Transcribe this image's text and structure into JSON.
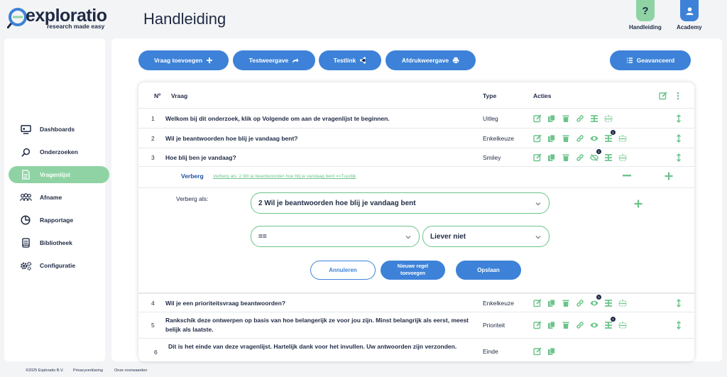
{
  "app": {
    "logo_word": "exploratio",
    "logo_tagline": "research made easy",
    "page_title": "Handleiding"
  },
  "top_nav": [
    {
      "label": "Handleiding",
      "icon": "question-icon",
      "glyph": "?",
      "color": "#8fd3a4"
    },
    {
      "label": "Academy",
      "icon": "user-icon",
      "glyph": "",
      "color": "#3d82d8"
    }
  ],
  "sidebar": {
    "items": [
      {
        "label": "Dashboards",
        "icon": "dashboard-icon"
      },
      {
        "label": "Onderzoeken",
        "icon": "search-icon"
      },
      {
        "label": "Vragenlijst",
        "icon": "document-icon",
        "active": true
      },
      {
        "label": "Afname",
        "icon": "users-icon"
      },
      {
        "label": "Rapportage",
        "icon": "pie-chart-icon"
      },
      {
        "label": "Bibliotheek",
        "icon": "book-icon"
      },
      {
        "label": "Configuratie",
        "icon": "gear-icon"
      }
    ]
  },
  "footer": {
    "copyright": "©2025 Exploratio B.V.",
    "privacy": "Privacyverklaring",
    "terms": "Onze voorwaarden"
  },
  "toolbar": {
    "add_question": "Vraag toevoegen",
    "test_view": "Testweergave",
    "test_link": "Testlink",
    "print_view": "Afdrukweergave",
    "advanced": "Geavanceerd"
  },
  "table": {
    "headers": {
      "number": "Nº",
      "question": "Vraag",
      "type": "Type",
      "actions": "Acties"
    },
    "rows": [
      {
        "number": "1",
        "question": "Welkom bij dit onderzoek, klik op Volgende om aan de vragenlijst te beginnen.",
        "type": "Uitleg"
      },
      {
        "number": "2",
        "question": "Wil je beantwoorden hoe blij je vandaag bent?",
        "type": "Enkelkeuze",
        "badge_filter": "1"
      },
      {
        "number": "3",
        "question": "Hoe blij ben je vandaag?",
        "type": "Smiley",
        "badge_hide": "1"
      },
      {
        "number": "4",
        "question": "Wil je een prioriteitsvraag beantwoorden?",
        "type": "Enkelkeuze",
        "badge_eye": "1"
      },
      {
        "number": "5",
        "question": "Rankschik deze ontwerpen op basis van hoe belangerijk ze voor jou zijn. Minst belangrijk als eerst, meest belijk als laatste.",
        "type": "Prioriteit",
        "badge_filter": "1"
      },
      {
        "number": "6",
        "question": "Dit is het einde van deze vragenlijst. Hartelijk dank voor het invullen. Uw antwoorden zijn verzonden.",
        "type": "Einde"
      }
    ]
  },
  "hide_rule": {
    "label": "Verberg",
    "summary": "Verberg als: 2 Wil je beantwoorden hoe blij je vandaag bent ==Tuurlijk",
    "condition_label": "Verberg als:",
    "question_select": "2 Wil je beantwoorden hoe blij je vandaag bent",
    "operator_select": "==",
    "value_select": "Liever niet",
    "cancel": "Annuleren",
    "new_rule_line1": "Nieuwe regel",
    "new_rule_line2": "toevoegen",
    "save": "Opslaan"
  },
  "colors": {
    "primary": "#3d82d8",
    "accent": "#6cc48a",
    "text": "#1f2a44"
  }
}
